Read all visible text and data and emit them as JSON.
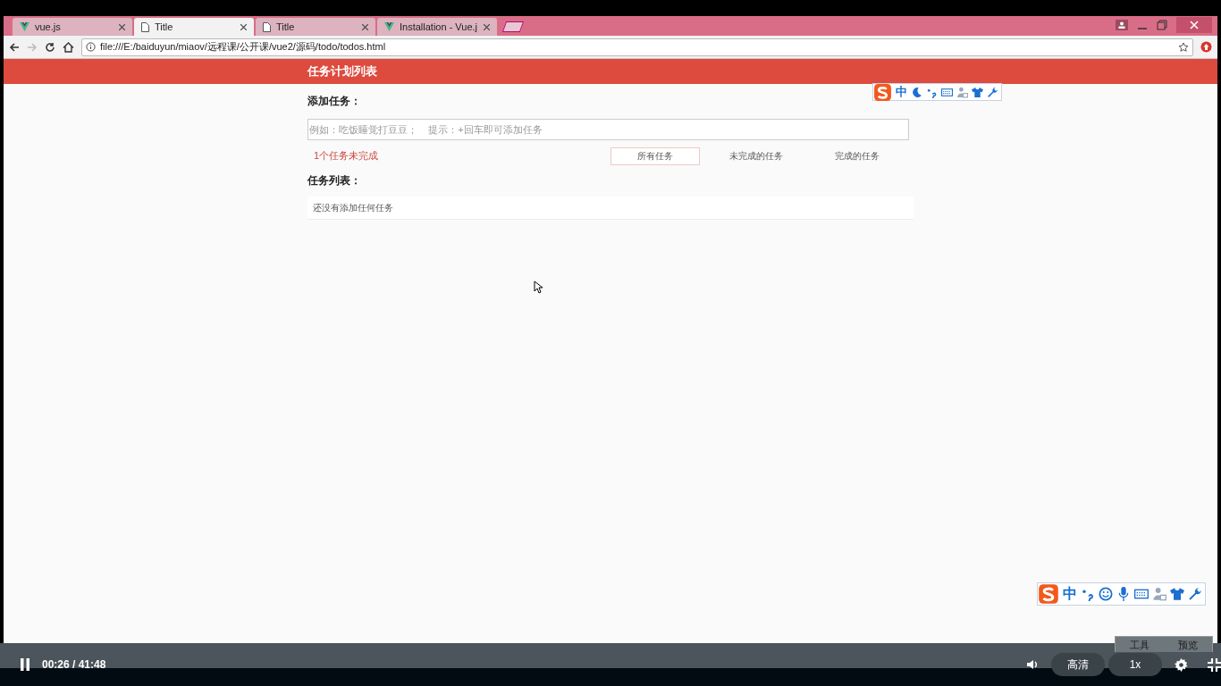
{
  "browser": {
    "tabs": [
      {
        "title": "vue.js",
        "kind": "vue",
        "selected": false
      },
      {
        "title": "Title",
        "kind": "page",
        "selected": true
      },
      {
        "title": "Title",
        "kind": "page",
        "selected": false
      },
      {
        "title": "Installation - Vue.j",
        "kind": "vue",
        "selected": false
      }
    ],
    "address": "file:///E:/baiduyun/miaov/远程课/公开课/vue2/源码/todo/todos.html"
  },
  "app": {
    "header": "任务计划列表",
    "add_label": "添加任务：",
    "input_placeholder": "例如：吃饭睡觉打豆豆；    提示：+回车即可添加任务",
    "remaining": "1个任务未完成",
    "filters": [
      {
        "label": "所有任务",
        "selected": true
      },
      {
        "label": "未完成的任务",
        "selected": false
      },
      {
        "label": "完成的任务",
        "selected": false
      }
    ],
    "list_label": "任务列表：",
    "empty_text": "还没有添加任何任务"
  },
  "ime_toolbars": [
    {
      "label": "中"
    },
    {
      "label": "中"
    }
  ],
  "tool_panel": {
    "items": [
      "工具",
      "预览"
    ]
  },
  "player": {
    "playing": true,
    "time": "00:26 / 41:48",
    "quality": "高清",
    "speed": "1x"
  }
}
